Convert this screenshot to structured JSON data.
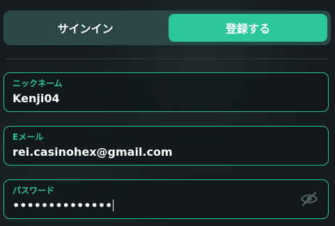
{
  "tabs": {
    "signin_label": "サインイン",
    "register_label": "登録する"
  },
  "form": {
    "nickname": {
      "label": "ニックネーム",
      "value": "Kenji04"
    },
    "email": {
      "label": "Eメール",
      "value": "rei.casinohex@gmail.com"
    },
    "password": {
      "label": "パスワード",
      "value": "••••••••••••••",
      "toggle_icon": "eye-off-icon"
    }
  },
  "colors": {
    "accent": "#2bc79a",
    "tab_bg": "#2a4648",
    "background": "#151b1e"
  }
}
